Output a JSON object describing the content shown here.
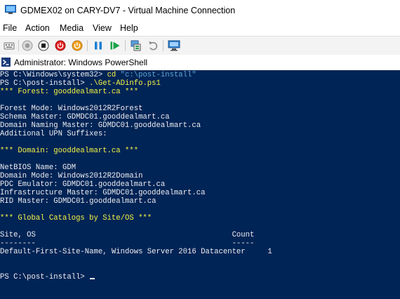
{
  "window": {
    "title": "GDMEX02 on CARY-DV7 - Virtual Machine Connection"
  },
  "menu": {
    "items": [
      "File",
      "Action",
      "Media",
      "View",
      "Help"
    ]
  },
  "toolbar": {
    "buttons": [
      {
        "icon": "ctrl-alt-del-icon"
      },
      {
        "icon": "start-icon"
      },
      {
        "icon": "turn-off-icon"
      },
      {
        "icon": "shut-down-icon"
      },
      {
        "icon": "save-icon"
      },
      {
        "icon": "pause-icon"
      },
      {
        "icon": "reset-icon"
      },
      {
        "icon": "checkpoint-icon"
      },
      {
        "icon": "revert-icon"
      },
      {
        "icon": "enhanced-session-icon"
      }
    ]
  },
  "inner_window": {
    "title": "Administrator: Windows PowerShell"
  },
  "console": {
    "lines": [
      {
        "prefix": "PS C:\\Windows\\system32> ",
        "cmd": "cd",
        "arg": " \"c:\\post-install\"",
        "style": "command"
      },
      {
        "prefix": "PS C:\\post-install> ",
        "cmd": ".\\Get-ADinfo.ps1",
        "arg": "",
        "style": "command"
      },
      {
        "text": "*** Forest: gooddealmart.ca ***",
        "style": "yellow"
      },
      {
        "text": "",
        "style": "normal"
      },
      {
        "text": "Forest Mode: Windows2012R2Forest",
        "style": "normal"
      },
      {
        "text": "Schema Master: GDMDC01.gooddealmart.ca",
        "style": "normal"
      },
      {
        "text": "Domain Naming Master: GDMDC01.gooddealmart.ca",
        "style": "normal"
      },
      {
        "text": "Additional UPN Suffixes:",
        "style": "normal"
      },
      {
        "text": "",
        "style": "normal"
      },
      {
        "text": "*** Domain: gooddealmart.ca ***",
        "style": "yellow"
      },
      {
        "text": "",
        "style": "normal"
      },
      {
        "text": "NetBIOS Name: GDM",
        "style": "normal"
      },
      {
        "text": "Domain Mode: Windows2012R2Domain",
        "style": "normal"
      },
      {
        "text": "PDC Emulator: GDMDC01.gooddealmart.ca",
        "style": "normal"
      },
      {
        "text": "Infrastructure Master: GDMDC01.gooddealmart.ca",
        "style": "normal"
      },
      {
        "text": "RID Master: GDMDC01.gooddealmart.ca",
        "style": "normal"
      },
      {
        "text": "",
        "style": "normal"
      },
      {
        "text": "*** Global Catalogs by Site/OS ***",
        "style": "yellow"
      },
      {
        "text": "",
        "style": "normal"
      },
      {
        "text": "Site, OS                                            Count",
        "style": "normal"
      },
      {
        "text": "--------                                            -----",
        "style": "normal"
      },
      {
        "text": "Default-First-Site-Name, Windows Server 2016 Datacenter     1",
        "style": "normal"
      },
      {
        "text": "",
        "style": "normal"
      },
      {
        "text": "",
        "style": "normal"
      },
      {
        "prefix": "PS C:\\post-install> ",
        "cmd": "",
        "arg": "",
        "style": "prompt"
      }
    ]
  }
}
